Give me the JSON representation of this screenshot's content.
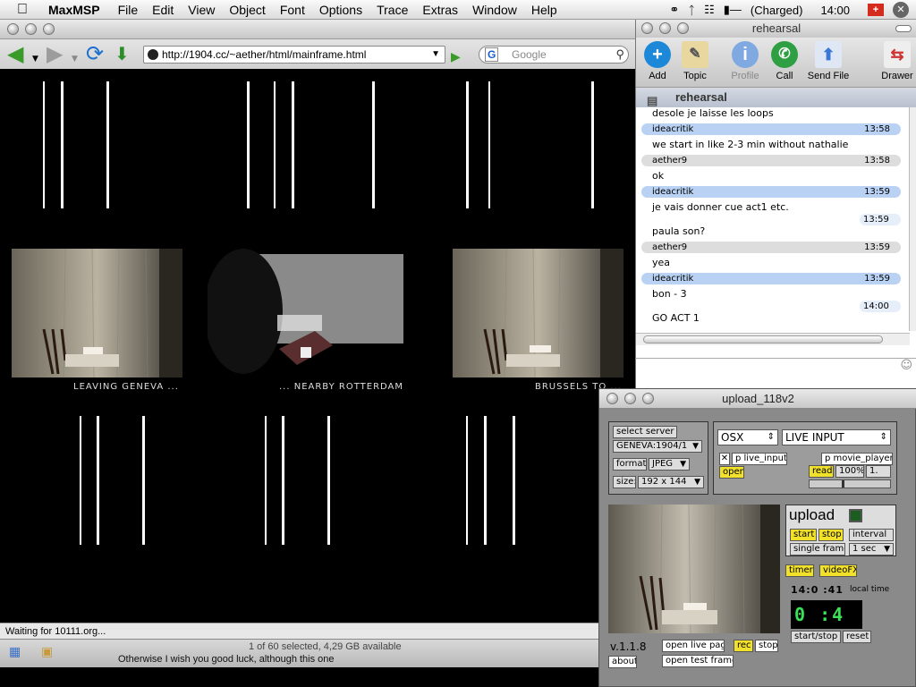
{
  "menubar": {
    "app": "MaxMSP",
    "items": [
      "File",
      "Edit",
      "View",
      "Object",
      "Font",
      "Options",
      "Trace",
      "Extras",
      "Window",
      "Help"
    ],
    "battery": "(Charged)",
    "clock": "14:00",
    "flag": "+"
  },
  "browser": {
    "url": "http://1904.cc/~aether/html/mainframe.html",
    "search_placeholder": "Google",
    "search_engine": "G",
    "status": "Waiting for 10111.org...",
    "finder_text": "1 of 60 selected, 4,29 GB available",
    "finder_subtext": "Otherwise I wish you good luck, although this one",
    "captions": [
      "LEAVING GENEVA ...",
      "... NEARBY ROTTERDAM",
      "BRUSSELS TO ..."
    ]
  },
  "chat": {
    "window_title": "rehearsal",
    "room": "rehearsal",
    "toolbar": [
      {
        "label": "Add",
        "icon": "add-icon",
        "color": "#1e88d8"
      },
      {
        "label": "Topic",
        "icon": "topic-icon",
        "color": "#d9b24a"
      },
      {
        "label": "Profile",
        "icon": "profile-icon",
        "color": "#6aa0dd"
      },
      {
        "label": "Call",
        "icon": "call-icon",
        "color": "#2ea043"
      },
      {
        "label": "Send File",
        "icon": "send-file-icon",
        "color": "#5d8fd8"
      },
      {
        "label": "Drawer",
        "icon": "drawer-icon",
        "color": "#c33"
      }
    ],
    "messages": [
      {
        "from": "",
        "time": "",
        "text": "desole je laisse les loops",
        "style": "none"
      },
      {
        "from": "ideacritik",
        "time": "13:58",
        "text": "we start in like 2-3 min without nathalie",
        "style": "blue"
      },
      {
        "from": "aether9",
        "time": "13:58",
        "text": "ok",
        "style": "gray"
      },
      {
        "from": "ideacritik",
        "time": "13:59",
        "text": "je vais donner cue act1 etc.",
        "style": "blue"
      },
      {
        "from": "",
        "time": "13:59",
        "text": "paula son?",
        "style": "self"
      },
      {
        "from": "aether9",
        "time": "13:59",
        "text": "yea",
        "style": "gray"
      },
      {
        "from": "ideacritik",
        "time": "13:59",
        "text": "bon - 3",
        "style": "blue"
      },
      {
        "from": "",
        "time": "14:00",
        "text": "GO ACT 1",
        "style": "self"
      }
    ]
  },
  "max": {
    "title": "upload_118v2",
    "select_server": "select server",
    "server": "GENEVA:1904/1",
    "format_label": "format:",
    "format": "JPEG",
    "size_label": "size:",
    "size": "192 x 144",
    "os": "OSX",
    "input": "LIVE INPUT",
    "p_live_input": "p live_input",
    "p_movie_player": "p movie_player",
    "open": "open",
    "read": "read",
    "percent": "100%",
    "rate": "1.",
    "upload": "upload",
    "start": "start",
    "stop": "stop",
    "interval": "interval",
    "single_frame": "single frame",
    "interval_value": "1 sec",
    "timer": "timer",
    "videofx": "videoFX",
    "time": "14:0 :41",
    "local_time": "local time",
    "counter": "0 :4",
    "start_stop": "start/stop",
    "reset": "reset",
    "version": "v.1.1.8",
    "open_live_page": "open live page",
    "rec": "rec",
    "stop2": "stop",
    "about": "about",
    "open_test_frame": "open test frame"
  }
}
